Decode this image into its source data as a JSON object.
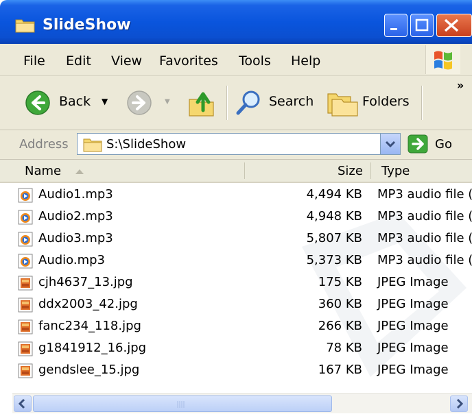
{
  "window": {
    "title": "SlideShow"
  },
  "menu": [
    "File",
    "Edit",
    "View",
    "Favorites",
    "Tools",
    "Help"
  ],
  "toolbar": {
    "back_label": "Back",
    "search_label": "Search",
    "folders_label": "Folders",
    "overflow": "»"
  },
  "address": {
    "label": "Address",
    "value": "S:\\SlideShow",
    "go_label": "Go"
  },
  "columns": {
    "name": "Name",
    "size": "Size",
    "type": "Type"
  },
  "files": [
    {
      "name": "Audio1.mp3",
      "size": "4,494 KB",
      "type": "MP3 audio file (",
      "icon": "mp3-file-icon"
    },
    {
      "name": "Audio2.mp3",
      "size": "4,948 KB",
      "type": "MP3 audio file (",
      "icon": "mp3-file-icon"
    },
    {
      "name": "Audio3.mp3",
      "size": "5,807 KB",
      "type": "MP3 audio file (",
      "icon": "mp3-file-icon"
    },
    {
      "name": "Audio.mp3",
      "size": "5,373 KB",
      "type": "MP3 audio file (",
      "icon": "mp3-file-icon"
    },
    {
      "name": "cjh4637_13.jpg",
      "size": "175 KB",
      "type": "JPEG Image",
      "icon": "jpeg-file-icon"
    },
    {
      "name": "ddx2003_42.jpg",
      "size": "360 KB",
      "type": "JPEG Image",
      "icon": "jpeg-file-icon"
    },
    {
      "name": "fanc234_118.jpg",
      "size": "266 KB",
      "type": "JPEG Image",
      "icon": "jpeg-file-icon"
    },
    {
      "name": "g1841912_16.jpg",
      "size": "78 KB",
      "type": "JPEG Image",
      "icon": "jpeg-file-icon"
    },
    {
      "name": "gendslee_15.jpg",
      "size": "167 KB",
      "type": "JPEG Image",
      "icon": "jpeg-file-icon"
    }
  ],
  "colors": {
    "titlebar": "#0a55dd",
    "chrome": "#ece9d8",
    "close": "#c9401e"
  }
}
